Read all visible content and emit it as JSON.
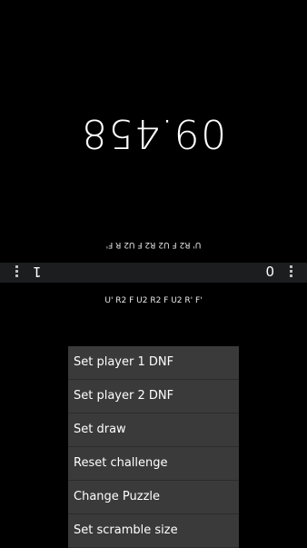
{
  "player1": {
    "timer": "09.458",
    "scramble": "U' R2 F U2 R2 F U2 R F'",
    "score": "1"
  },
  "player2": {
    "score": "0",
    "scramble": "U' R2 F U2 R2 F U2 R' F'"
  },
  "menu": {
    "items": [
      {
        "label": "Set player 1 DNF"
      },
      {
        "label": "Set player 2 DNF"
      },
      {
        "label": "Set draw"
      },
      {
        "label": "Reset challenge"
      },
      {
        "label": "Change Puzzle"
      },
      {
        "label": "Set scramble size"
      }
    ]
  }
}
